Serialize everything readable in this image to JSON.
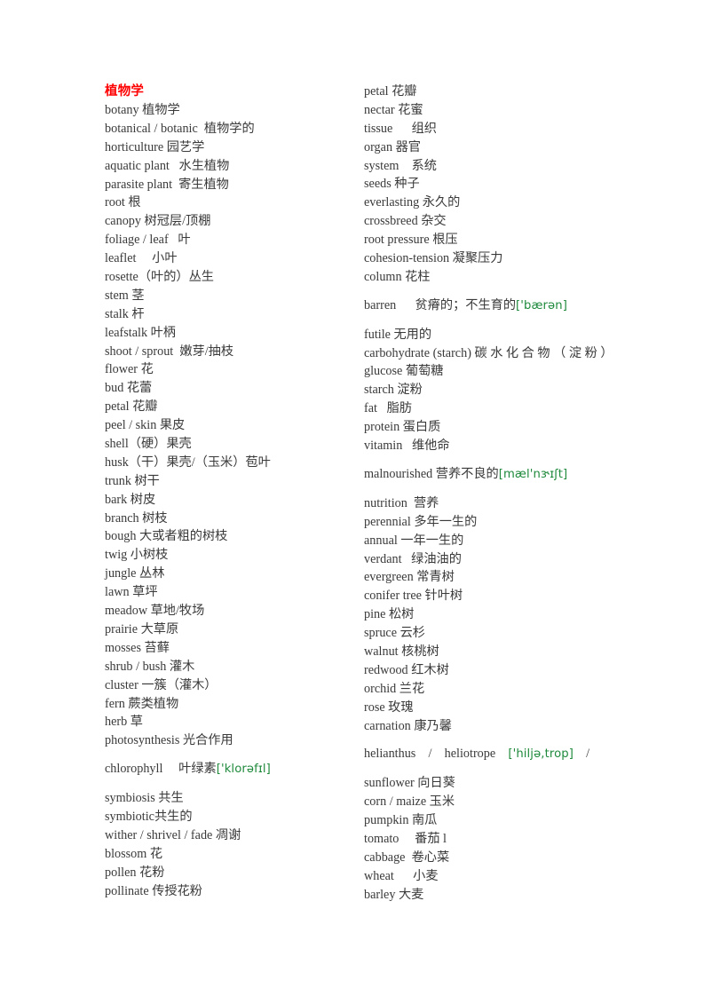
{
  "document": {
    "title": "植物学",
    "title_color": "#ff0000",
    "body_color": "#3a3a3a",
    "ipa_color": "#1f8a3c",
    "background": "#ffffff"
  },
  "left_column": {
    "entries": [
      {
        "text": "botany 植物学"
      },
      {
        "text": "botanical / botanic  植物学的"
      },
      {
        "text": "horticulture 园艺学"
      },
      {
        "text": "aquatic plant   水生植物"
      },
      {
        "text": "parasite plant  寄生植物"
      },
      {
        "text": "root 根"
      },
      {
        "text": "canopy 树冠层/顶棚"
      },
      {
        "text": "foliage / leaf   叶"
      },
      {
        "text": "leaflet     小叶"
      },
      {
        "text": "rosette（叶的）丛生"
      },
      {
        "text": "stem 茎"
      },
      {
        "text": "stalk 杆"
      },
      {
        "text": "leafstalk 叶柄"
      },
      {
        "text": "shoot / sprout  嫩芽/抽枝"
      },
      {
        "text": "flower 花"
      },
      {
        "text": "bud 花蕾"
      },
      {
        "text": "petal 花瓣"
      },
      {
        "text": "peel / skin 果皮"
      },
      {
        "text": "shell（硬）果壳"
      },
      {
        "text": "husk（干）果壳/（玉米）苞叶"
      },
      {
        "text": "trunk 树干"
      },
      {
        "text": "bark 树皮"
      },
      {
        "text": "branch 树枝"
      },
      {
        "text": "bough 大或者粗的树枝"
      },
      {
        "text": "twig 小树枝"
      },
      {
        "text": "jungle 丛林"
      },
      {
        "text": "lawn 草坪"
      },
      {
        "text": "meadow 草地/牧场"
      },
      {
        "text": "prairie 大草原"
      },
      {
        "text": "mosses 苔藓"
      },
      {
        "text": "shrub / bush 灌木"
      },
      {
        "text": "cluster 一簇（灌木）"
      },
      {
        "text": "fern 蕨类植物"
      },
      {
        "text": "herb 草"
      },
      {
        "text": "photosynthesis 光合作用"
      },
      {
        "text": "chlorophyll     叶绿素",
        "ipa": "['klorəfɪl]",
        "spaced": true
      },
      {
        "text": "symbiosis 共生"
      },
      {
        "text": "symbiotic共生的"
      },
      {
        "text": "wither / shrivel / fade 凋谢"
      },
      {
        "text": "blossom 花"
      },
      {
        "text": "pollen 花粉"
      },
      {
        "text": "pollinate 传授花粉"
      }
    ]
  },
  "right_column": {
    "entries": [
      {
        "text": "petal 花瓣"
      },
      {
        "text": "nectar 花蜜"
      },
      {
        "text": "tissue      组织"
      },
      {
        "text": "organ 器官"
      },
      {
        "text": "system    系统"
      },
      {
        "text": "seeds 种子"
      },
      {
        "text": "everlasting 永久的"
      },
      {
        "text": "crossbreed 杂交"
      },
      {
        "text": "root pressure 根压"
      },
      {
        "text": "cohesion-tension 凝聚压力"
      },
      {
        "text": "column 花柱"
      },
      {
        "text": "barren      贫瘠的；不生育的",
        "ipa": "['bærən]",
        "spaced": true
      },
      {
        "text": "futile 无用的"
      },
      {
        "text": "carbohydrate (starch) 碳 水 化 合 物 （ 淀 粉 ）"
      },
      {
        "text": "glucose 葡萄糖"
      },
      {
        "text": "starch 淀粉"
      },
      {
        "text": "fat   脂肪"
      },
      {
        "text": "protein 蛋白质"
      },
      {
        "text": "vitamin   维他命"
      },
      {
        "text": "malnourished 营养不良的",
        "ipa": "[mæl'nɝɪʃt]",
        "spaced": true
      },
      {
        "text": "nutrition  营养"
      },
      {
        "text": "perennial 多年一生的"
      },
      {
        "text": "annual 一年一生的"
      },
      {
        "text": "verdant   绿油油的"
      },
      {
        "text": "evergreen 常青树"
      },
      {
        "text": "conifer tree 针叶树"
      },
      {
        "text": "pine 松树"
      },
      {
        "text": "spruce 云杉"
      },
      {
        "text": "walnut 核桃树"
      },
      {
        "text": "redwood 红木树"
      },
      {
        "text": "orchid 兰花"
      },
      {
        "text": "rose 玫瑰"
      },
      {
        "text": "carnation 康乃馨"
      },
      {
        "text": "helianthus    /    heliotrope    ",
        "ipa": "['hiljə,trop]",
        "text_after": "    /",
        "spaced": true
      },
      {
        "text": "sunflower 向日葵"
      },
      {
        "text": "corn / maize 玉米"
      },
      {
        "text": "pumpkin 南瓜"
      },
      {
        "text": "tomato     番茄 l"
      },
      {
        "text": "cabbage  卷心菜"
      },
      {
        "text": "wheat      小麦"
      },
      {
        "text": "barley 大麦"
      }
    ]
  }
}
